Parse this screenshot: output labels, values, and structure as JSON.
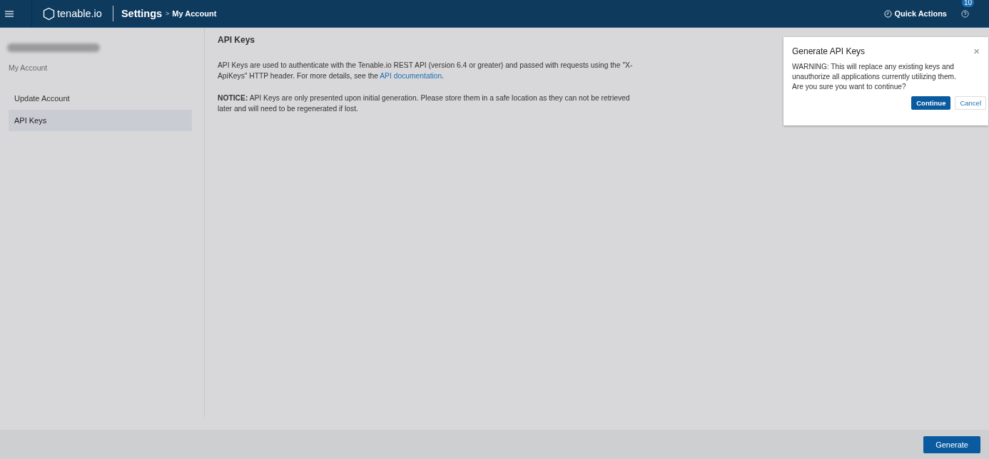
{
  "header": {
    "logo": "tenable.io",
    "section": "Settings",
    "breadcrumb_separator": ">",
    "breadcrumb": "My Account",
    "quick_actions": "Quick Actions",
    "help_badge": "10"
  },
  "account": {
    "subtitle": "My Account"
  },
  "sidebar": {
    "items": [
      {
        "label": "Update Account",
        "selected": false
      },
      {
        "label": "API Keys",
        "selected": true
      }
    ]
  },
  "content": {
    "title": "API Keys",
    "intro_before": "API Keys are used to authenticate with the Tenable.io REST API (version 6.4 or greater) and passed with requests using the \"X-ApiKeys\" HTTP header. For more details, see the ",
    "intro_link": "API documentation",
    "intro_after": ".",
    "notice": "**NOTICE:** API Keys are only presented upon initial generation. Please store them in a safe location as they can not be retrieved later and will need to be regenerated if lost."
  },
  "dialog": {
    "title": "Generate API Keys",
    "close": "×",
    "message": "WARNING: This will replace any existing keys and unauthorize all applications currently utilizing them. Are you sure you want to continue?",
    "buttons": [
      {
        "label": "Continue",
        "kind": "primary"
      },
      {
        "label": "Cancel",
        "kind": "secondary"
      }
    ]
  },
  "footer": {
    "button": "Generate"
  }
}
